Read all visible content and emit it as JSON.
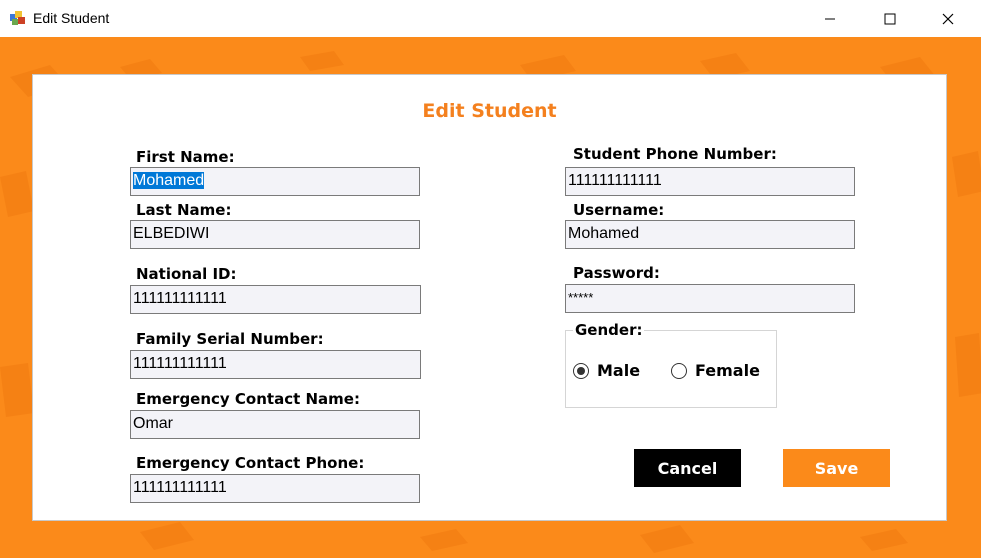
{
  "window": {
    "title": "Edit Student",
    "controls": {
      "minimize": "minimize-icon",
      "maximize": "maximize-icon",
      "close": "close-icon"
    }
  },
  "form": {
    "heading": "Edit Student",
    "left": {
      "first_name": {
        "label": "First Name:",
        "value": "Mohamed"
      },
      "last_name": {
        "label": "Last Name:",
        "value": "ELBEDIWI"
      },
      "national_id": {
        "label": "National ID:",
        "value": "111111111111"
      },
      "family_serial": {
        "label": "Family Serial Number:",
        "value": "111111111111"
      },
      "emergency_name": {
        "label": "Emergency Contact Name:",
        "value": "Omar"
      },
      "emergency_phone": {
        "label": "Emergency Contact Phone:",
        "value": "111111111111"
      }
    },
    "right": {
      "student_phone": {
        "label": "Student Phone Number:",
        "value": "111111111111"
      },
      "username": {
        "label": "Username:",
        "value": "Mohamed"
      },
      "password": {
        "label": "Password:",
        "value": "*****"
      }
    },
    "gender": {
      "label": "Gender:",
      "options": [
        "Male",
        "Female"
      ],
      "selected": "Male"
    },
    "buttons": {
      "cancel": "Cancel",
      "save": "Save"
    }
  },
  "colors": {
    "accent": "#f4801e",
    "background": "#fb8a1a",
    "selection": "#0078d7",
    "cancel_button": "#000000",
    "save_button": "#fb8a1a"
  }
}
